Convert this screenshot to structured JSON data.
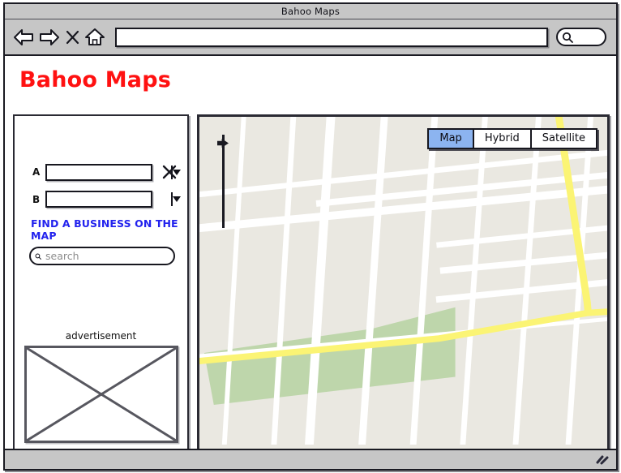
{
  "window": {
    "title": "Bahoo Maps"
  },
  "toolbar": {
    "back_icon": "back-arrow-icon",
    "forward_icon": "forward-arrow-icon",
    "stop_icon": "stop-x-icon",
    "home_icon": "home-icon",
    "url_value": "",
    "url_placeholder": "",
    "search_icon": "search-magnifier-icon",
    "search_value": "",
    "search_placeholder": ""
  },
  "page": {
    "title": "Bahoo Maps",
    "title_color": "#ff1111"
  },
  "sidebar": {
    "route": {
      "rows": [
        {
          "label": "A",
          "value": "",
          "placeholder": "",
          "dropdown_icon": "chevron-down-icon"
        },
        {
          "label": "B",
          "value": "",
          "placeholder": "",
          "dropdown_icon": "chevron-down-icon"
        }
      ],
      "clear_icon": "close-x-icon"
    },
    "find_business_label": "FIND A BUSINESS ON THE MAP",
    "find_business_label_color": "#2222ee",
    "business_search": {
      "icon": "search-magnifier-icon",
      "value": "",
      "placeholder": "search"
    },
    "advertisement": {
      "label": "advertisement",
      "placeholder_icon": "image-placeholder-icon"
    }
  },
  "map": {
    "type_buttons": [
      {
        "label": "Map",
        "selected": true
      },
      {
        "label": "Hybrid",
        "selected": false
      },
      {
        "label": "Satellite",
        "selected": false
      }
    ],
    "selected_type": "Map",
    "zoom_slider": {
      "icon": "zoom-slider-handle-icon",
      "position_percent": 5
    },
    "colors": {
      "land": "#eae8e1",
      "street": "#ffffff",
      "highway": "#fbf474",
      "park": "#bed6ab"
    }
  },
  "status_bar": {
    "text": "",
    "resize_grip_icon": "resize-grip-icon"
  }
}
